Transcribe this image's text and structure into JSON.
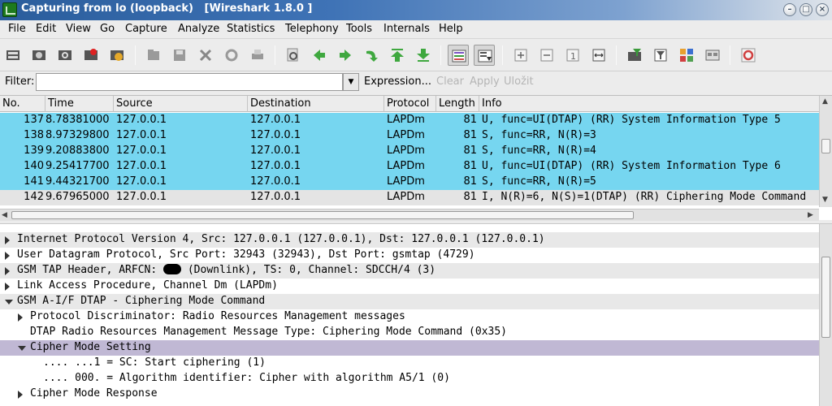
{
  "window": {
    "title": "Capturing from lo (loopback)   [Wireshark 1.8.0 ]",
    "buttons": [
      "minimize",
      "maximize",
      "close"
    ]
  },
  "menu": [
    "File",
    "Edit",
    "View",
    "Go",
    "Capture",
    "Analyze",
    "Statistics",
    "Telephony",
    "Tools",
    "Internals",
    "Help"
  ],
  "filter": {
    "label": "Filter:",
    "value": "",
    "expression": "Expression...",
    "clear": "Clear",
    "apply": "Apply",
    "save": "Uložit"
  },
  "packet_list": {
    "columns": [
      "No.",
      "Time",
      "Source",
      "Destination",
      "Protocol",
      "Length",
      "Info"
    ],
    "rows": [
      {
        "no": "137",
        "time": "8.78381000",
        "src": "127.0.0.1",
        "dst": "127.0.0.1",
        "proto": "LAPDm",
        "len": "81",
        "info": "U, func=UI(DTAP) (RR) System Information Type 5",
        "selected": true
      },
      {
        "no": "138",
        "time": "8.97329800",
        "src": "127.0.0.1",
        "dst": "127.0.0.1",
        "proto": "LAPDm",
        "len": "81",
        "info": "S, func=RR, N(R)=3",
        "selected": true
      },
      {
        "no": "139",
        "time": "9.20883800",
        "src": "127.0.0.1",
        "dst": "127.0.0.1",
        "proto": "LAPDm",
        "len": "81",
        "info": "S, func=RR, N(R)=4",
        "selected": true
      },
      {
        "no": "140",
        "time": "9.25417700",
        "src": "127.0.0.1",
        "dst": "127.0.0.1",
        "proto": "LAPDm",
        "len": "81",
        "info": "U, func=UI(DTAP) (RR) System Information Type 6",
        "selected": true
      },
      {
        "no": "141",
        "time": "9.44321700",
        "src": "127.0.0.1",
        "dst": "127.0.0.1",
        "proto": "LAPDm",
        "len": "81",
        "info": "S, func=RR, N(R)=5",
        "selected": true
      },
      {
        "no": "142",
        "time": "9.67965000",
        "src": "127.0.0.1",
        "dst": "127.0.0.1",
        "proto": "LAPDm",
        "len": "81",
        "info": "I, N(R)=6, N(S)=1(DTAP) (RR) Ciphering Mode Command",
        "selected": false
      }
    ]
  },
  "details": {
    "rows": [
      {
        "text": "Internet Protocol Version 4, Src: 127.0.0.1 (127.0.0.1), Dst: 127.0.0.1 (127.0.0.1)",
        "toggle": "collapsed"
      },
      {
        "text": "User Datagram Protocol, Src Port: 32943 (32943), Dst Port: gsmtap (4729)",
        "toggle": "collapsed"
      },
      {
        "text_before": "GSM TAP Header, ARFCN: ",
        "text_after": " (Downlink), TS: 0, Channel: SDCCH/4 (3)",
        "toggle": "collapsed"
      },
      {
        "text": "Link Access Procedure, Channel Dm (LAPDm)",
        "toggle": "collapsed"
      },
      {
        "text": "GSM A-I/F DTAP - Ciphering Mode Command",
        "toggle": "expanded"
      },
      {
        "text": "Protocol Discriminator: Radio Resources Management messages",
        "toggle": "collapsed"
      },
      {
        "text": "DTAP Radio Resources Management Message Type: Ciphering Mode Command (0x35)",
        "toggle": "none"
      },
      {
        "text": "Cipher Mode Setting",
        "toggle": "expanded"
      },
      {
        "text": ".... ...1 = SC: Start ciphering (1)",
        "toggle": "none"
      },
      {
        "text": ".... 000. = Algorithm identifier: Cipher with algorithm A5/1 (0)",
        "toggle": "none"
      },
      {
        "text": "Cipher Mode Response",
        "toggle": "collapsed"
      }
    ]
  },
  "colors": {
    "selected_row": "#76d6f0",
    "normal_row": "#e4e4e4",
    "highlight_row": "#c0b8d4"
  }
}
